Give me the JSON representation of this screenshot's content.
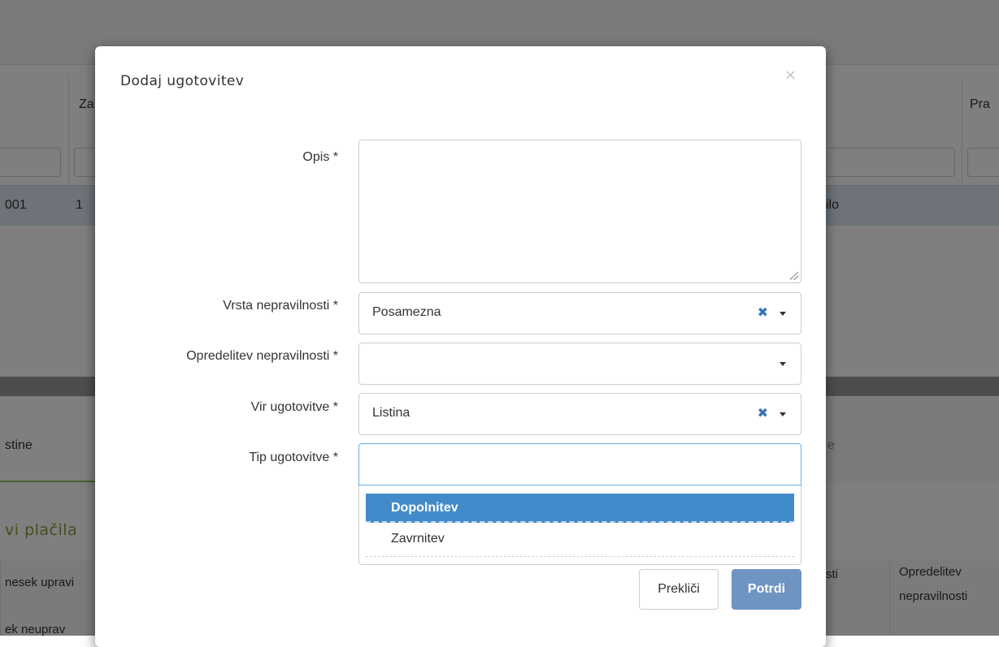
{
  "background": {
    "col_labels": [
      "Za",
      "Pra"
    ],
    "row_texts": [
      "001",
      "1",
      "ilo"
    ],
    "tabs": [
      "stine",
      "e"
    ],
    "section_title": "vi plačila",
    "table_headers": [
      "nesek upravi",
      "ek neuprav",
      "sti"
    ],
    "opredelitev_header_line1": "Opredelitev",
    "opredelitev_header_line2": "nepravilnosti"
  },
  "modal": {
    "title": "Dodaj ugotovitev",
    "close_symbol": "×",
    "fields": {
      "opis": {
        "label": "Opis *",
        "value": ""
      },
      "vrsta": {
        "label": "Vrsta nepravilnosti *",
        "value": "Posamezna"
      },
      "opredelitev": {
        "label": "Opredelitev nepravilnosti *",
        "value": ""
      },
      "vir": {
        "label": "Vir ugotovitve *",
        "value": "Listina"
      },
      "tip": {
        "label": "Tip ugotovitve *",
        "value": ""
      }
    },
    "clear_symbol": "✖",
    "dropdown_options": [
      "Dopolnitev",
      "Zavrnitev"
    ],
    "dropdown_selected": "Dopolnitev",
    "buttons": {
      "cancel": "Prekliči",
      "confirm": "Potrdi"
    }
  },
  "colors": {
    "primary": "#428bca",
    "confirm_button": "#6e95c2",
    "overlay": "rgba(0,0,0,0.5)"
  }
}
